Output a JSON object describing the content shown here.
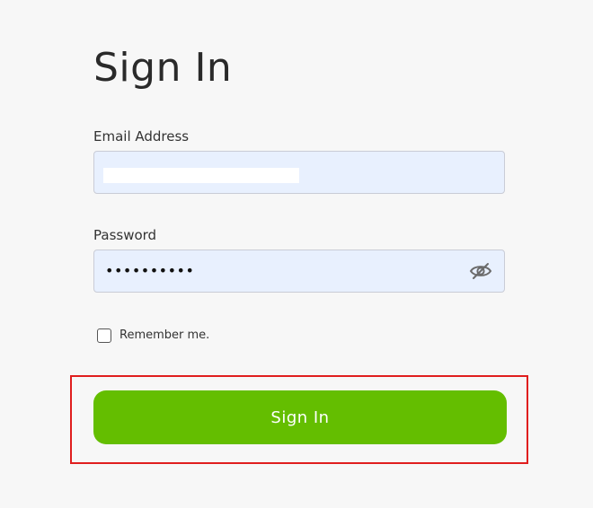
{
  "page": {
    "title": "Sign In"
  },
  "form": {
    "email": {
      "label": "Email Address",
      "value": ""
    },
    "password": {
      "label": "Password",
      "masked_value": "••••••••••",
      "toggle_icon": "eye-slash-icon"
    },
    "remember_me": {
      "label": "Remember me.",
      "checked": false
    },
    "submit_label": "Sign In"
  },
  "colors": {
    "background": "#f7f7f7",
    "input_fill": "#e8f0fe",
    "button_green": "#64be00",
    "highlight_red": "#e01e1e"
  }
}
